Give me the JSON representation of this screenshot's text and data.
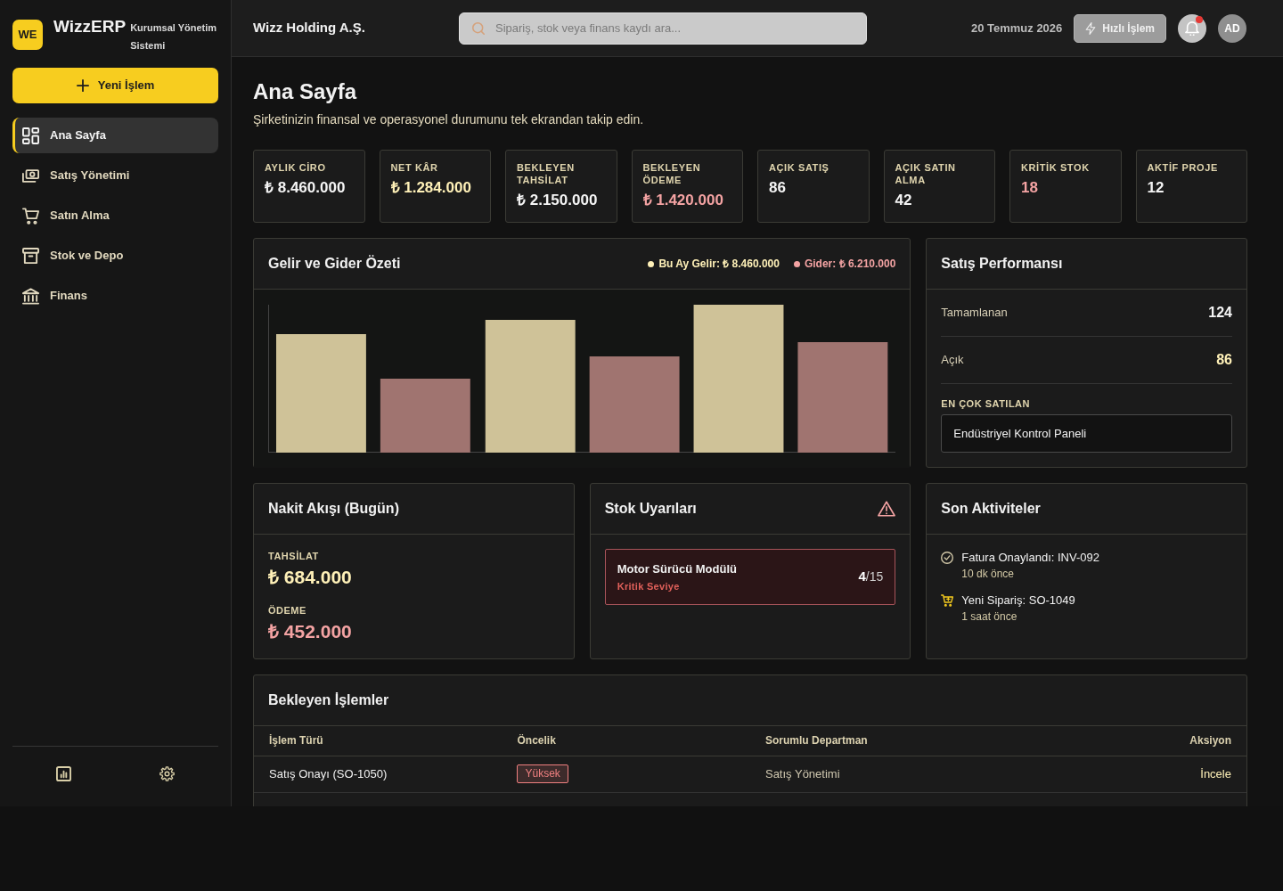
{
  "sidebar": {
    "logo": "WE",
    "brand": "WizzERP",
    "tagline": "Kurumsal Yönetim Sistemi",
    "new_button": "Yeni İşlem",
    "items": [
      {
        "label": "Ana Sayfa",
        "selected": true
      },
      {
        "label": "Satış Yönetimi",
        "selected": false
      },
      {
        "label": "Satın Alma",
        "selected": false
      },
      {
        "label": "Stok ve Depo",
        "selected": false
      },
      {
        "label": "Finans",
        "selected": false
      }
    ]
  },
  "topbar": {
    "company": "Wizz Holding A.Ş.",
    "search": {
      "placeholder": "Sipariş, stok veya finans kaydı ara..."
    },
    "date": "20 Temmuz 2026",
    "quick_button": "Hızlı İşlem",
    "notifications": {
      "unread": true
    },
    "avatar": "AD"
  },
  "page": {
    "title": "Ana Sayfa",
    "subtitle": "Şirketinizin finansal ve operasyonel durumunu tek ekrandan takip edin."
  },
  "kpis": [
    {
      "label": "AYLIK CİRO",
      "value": "₺ 8.460.000",
      "color": "#f5f5f5"
    },
    {
      "label": "NET KÂR",
      "value": "₺ 1.284.000",
      "color": "#fff1b8"
    },
    {
      "label": "BEKLEYEN TAHSİLAT",
      "value": "₺ 2.150.000",
      "color": "#f5f5f5"
    },
    {
      "label": "BEKLEYEN ÖDEME",
      "value": "₺ 1.420.000",
      "color": "#f4a3a3"
    },
    {
      "label": "AÇIK SATIŞ",
      "value": "86",
      "color": "#f5f5f5"
    },
    {
      "label": "AÇIK SATIN ALMA",
      "value": "42",
      "color": "#f5f5f5"
    },
    {
      "label": "KRİTİK STOK",
      "value": "18",
      "color": "#f4a3a3"
    },
    {
      "label": "AKTİF PROJE",
      "value": "12",
      "color": "#f5f5f5"
    }
  ],
  "income_chart": {
    "title": "Gelir ve Gider Özeti",
    "legend": [
      {
        "label": "Bu Ay Gelir: ₺ 8.460.000",
        "color": "#fff1b8"
      },
      {
        "label": "Gider: ₺ 6.210.000",
        "color": "#f4a3a3"
      }
    ]
  },
  "sales_performance": {
    "title": "Satış Performansı",
    "stats": [
      {
        "label": "Tamamlanan",
        "value": "124",
        "color": "#f5f5f5"
      },
      {
        "label": "Açık",
        "value": "86",
        "color": "#fff1b8"
      }
    ],
    "best_seller": {
      "label": "EN ÇOK SATILAN",
      "value": "Endüstriyel Kontrol Paneli"
    }
  },
  "cash_flow": {
    "title": "Nakit Akışı (Bugün)",
    "items": [
      {
        "label": "TAHSİLAT",
        "value": "₺ 684.000",
        "color": "#fff1b8"
      },
      {
        "label": "ÖDEME",
        "value": "₺ 452.000",
        "color": "#f4a3a3"
      }
    ]
  },
  "stock_alerts": {
    "title": "Stok Uyarıları",
    "alerts": [
      {
        "name": "Motor Sürücü Modülü",
        "level_label": "Kritik Seviye",
        "count": "**4**/15"
      }
    ]
  },
  "activities": {
    "title": "Son Aktiviteler",
    "items": [
      {
        "kind": "invoice",
        "text": "Fatura Onaylandı: INV-092",
        "time": "10 dk önce"
      },
      {
        "kind": "order",
        "text": "Yeni Sipariş: SO-1049",
        "time": "1 saat önce"
      }
    ]
  },
  "pending": {
    "title": "Bekleyen İşlemler",
    "columns": [
      "İşlem Türü",
      "Öncelik",
      "Sorumlu Departman",
      "Aksiyon"
    ],
    "rows": [
      {
        "type": "Satış Onayı (SO-1050)",
        "priority": "Yüksek",
        "color": "#f08080",
        "department": "Satış Yönetimi",
        "action": "İncele"
      }
    ]
  }
}
